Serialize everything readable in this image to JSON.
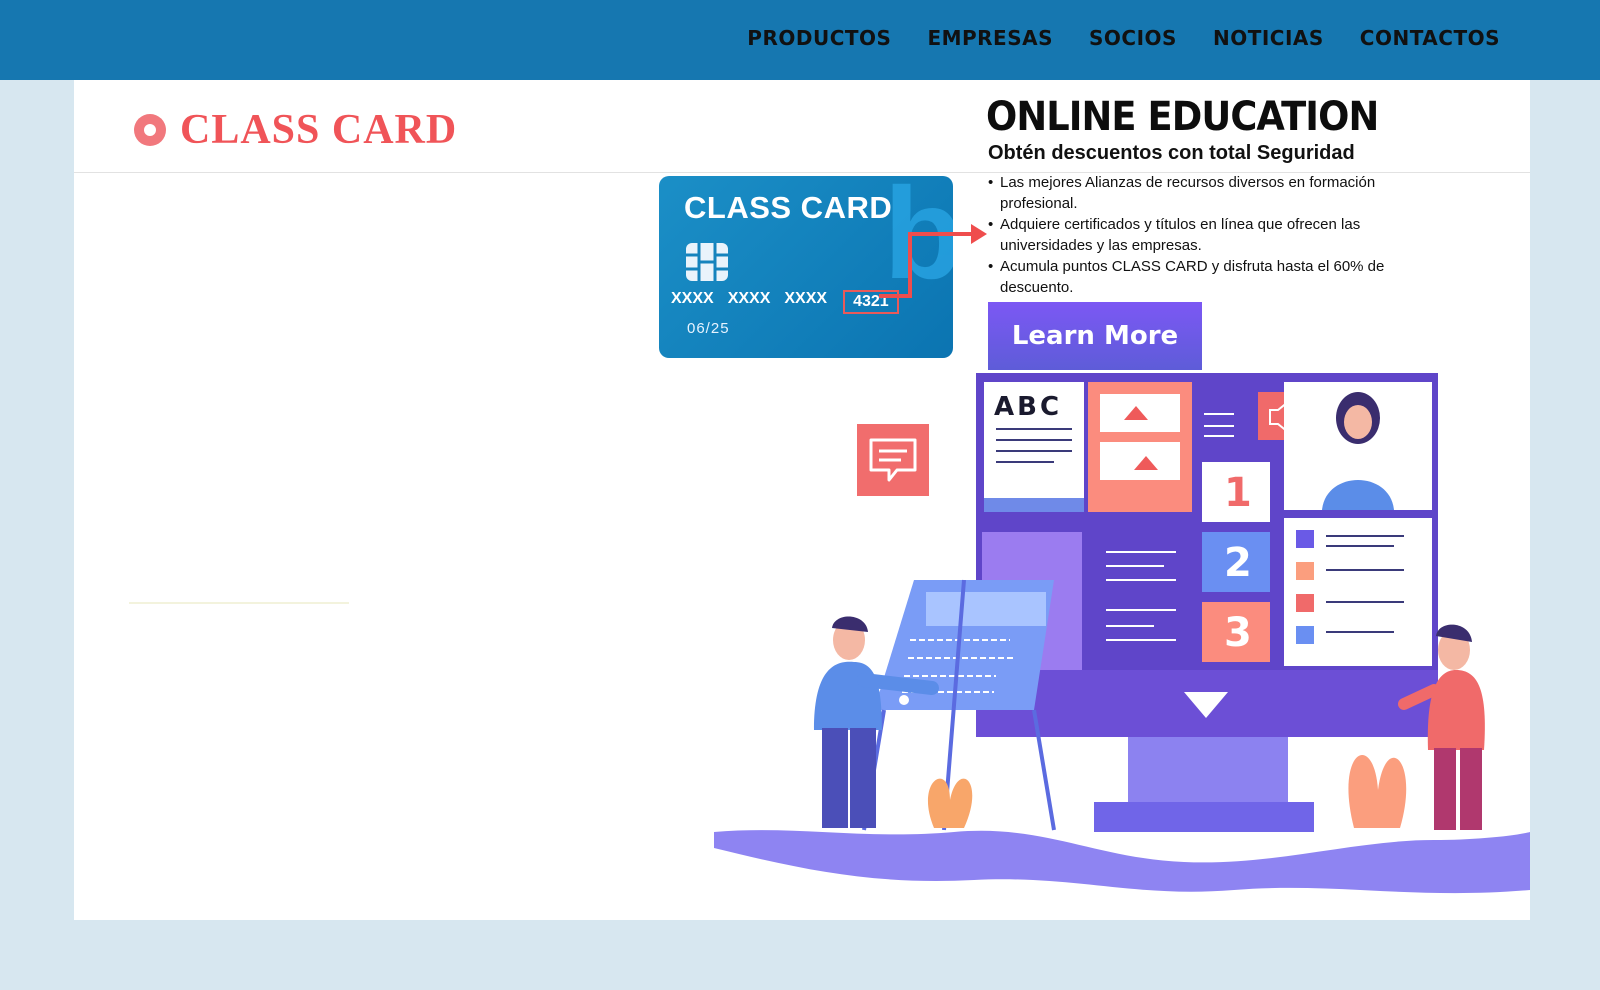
{
  "nav": {
    "items": [
      "PRODUCTOS",
      "EMPRESAS",
      "SOCIOS",
      "NOTICIAS",
      "CONTACTOS"
    ]
  },
  "brand": {
    "name": "CLASS CARD"
  },
  "card": {
    "title": "CLASS CARD",
    "number_groups": [
      "XXXX",
      "XXXX",
      "XXXX"
    ],
    "last_digits": "4321",
    "expiry": "06/25"
  },
  "promo": {
    "title": "ONLINE EDUCATION",
    "subtitle": "Obtén descuentos con total Seguridad",
    "bullets": [
      "Las mejores Alianzas de recursos diversos en formación profesional.",
      "Adquiere certificados y títulos en línea que ofrecen las universidades y las empresas.",
      "Acumula puntos CLASS CARD y disfruta hasta el 60% de descuento."
    ],
    "cta_label": "Learn More"
  },
  "illustration": {
    "abc_label": "ABC",
    "steps": [
      "1",
      "2",
      "3"
    ]
  },
  "colors": {
    "topbar": "#1677b0",
    "brand_red": "#f05458",
    "card_blue": "#0b74b1",
    "cta_purple": "#6a5ae6"
  }
}
